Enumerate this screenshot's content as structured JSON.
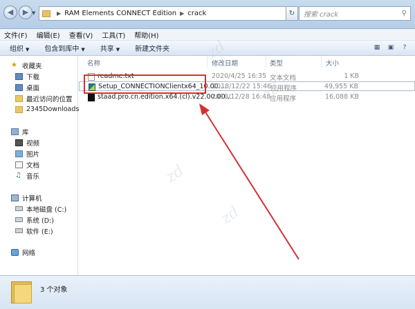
{
  "titlebar": {
    "breadcrumb": [
      "RAM Elements CONNECT Edition",
      "crack"
    ],
    "search_placeholder": "搜索 crack"
  },
  "menu": [
    "文件(F)",
    "编辑(E)",
    "查看(V)",
    "工具(T)",
    "帮助(H)"
  ],
  "toolbar": {
    "organize": "组织",
    "include_in_library": "包含到库中",
    "share": "共享",
    "new_folder": "新建文件夹"
  },
  "nav": {
    "favorites": "收藏夹",
    "downloads": "下载",
    "desktop": "桌面",
    "recent": "最近访问的位置",
    "downloads2345": "2345Downloads",
    "libraries": "库",
    "videos": "视频",
    "pictures": "图片",
    "documents": "文档",
    "music": "音乐",
    "computer": "计算机",
    "local_disk": "本地磁盘 (C:)",
    "system_d": "系统 (D:)",
    "software_e": "软件 (E:)",
    "network": "网络"
  },
  "columns": {
    "name": "名称",
    "date": "修改日期",
    "type": "类型",
    "size": "大小"
  },
  "files": [
    {
      "name": "readme.txt",
      "date": "2020/4/25 16:35",
      "type": "文本文档",
      "size": "1 KB",
      "icon": "text-file-icon"
    },
    {
      "name": "Setup_CONNECTIONClientx64_10.00....",
      "date": "2018/12/22 15:46",
      "type": "应用程序",
      "size": "49,955 KB",
      "icon": "setup-app-icon"
    },
    {
      "name": "staad.pro.cn.edition.x64.(cl).v22.00.00...",
      "date": "2018/12/28 16:48",
      "type": "应用程序",
      "size": "16,088 KB",
      "icon": "staad-app-icon"
    }
  ],
  "status": {
    "count": "3 个对象"
  },
  "colors": {
    "annotation": "#d32f2f",
    "accent": "#3a6596"
  }
}
